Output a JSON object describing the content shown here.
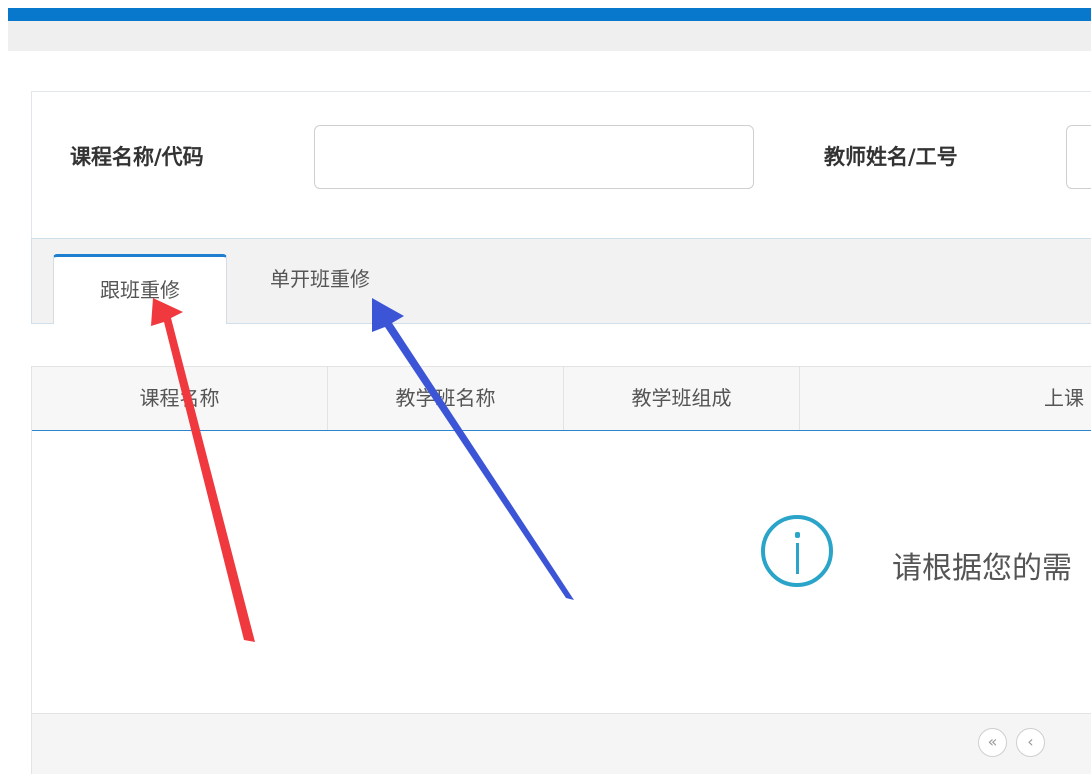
{
  "search": {
    "course_label": "课程名称/代码",
    "course_value": "",
    "teacher_label": "教师姓名/工号",
    "teacher_value": ""
  },
  "tabs": [
    {
      "label": "跟班重修",
      "active": true
    },
    {
      "label": "单开班重修",
      "active": false
    }
  ],
  "grid": {
    "columns": [
      "课程名称",
      "教学班名称",
      "教学班组成",
      "上课"
    ],
    "empty_message": "请根据您的需"
  },
  "pager": {
    "first_icon": "double-chevron-left-icon",
    "prev_icon": "chevron-left-icon",
    "first_symbol": "«",
    "prev_symbol": "‹"
  },
  "colors": {
    "top_bar": "#0778cc",
    "tab_accent": "#1f7fcf",
    "info_icon": "#2aa4c9",
    "annotation_red": "#f0393e",
    "annotation_blue": "#3b55d6"
  }
}
